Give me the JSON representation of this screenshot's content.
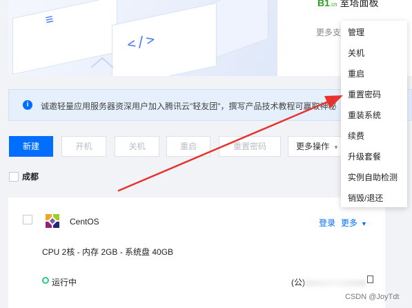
{
  "top_card": {
    "corner_title_prefix": "B1",
    "corner_title_suffix": ".cn",
    "corner_title_text": "室塔面板",
    "more_text": "更多支"
  },
  "notice": {
    "text": "诚邀轻量应用服务器资深用户加入腾讯云\"轻友团\"，撰写产品技术教程可赢取神秘"
  },
  "toolbar": {
    "new_label": "新建",
    "start_label": "开机",
    "stop_label": "关机",
    "restart_label": "重启",
    "reset_password_label": "重置密码",
    "more_label": "更多操作"
  },
  "region": {
    "label": "成都"
  },
  "instance": {
    "os_name": "CentOS",
    "login_label": "登录",
    "more_label": "更多",
    "spec": "CPU 2核 - 内存 2GB - 系统盘 40GB",
    "status": "运行中",
    "ip_prefix": "(公)",
    "status_color": "#29cc85"
  },
  "menu": {
    "items": [
      "管理",
      "关机",
      "重启",
      "重置密码",
      "重装系统",
      "续费",
      "升级套餐",
      "实例自助检测",
      "销毁/退还"
    ]
  },
  "watermark": "CSDN @JoyTdt",
  "colors": {
    "primary": "#006eff",
    "annotation_arrow": "#e8322e"
  }
}
